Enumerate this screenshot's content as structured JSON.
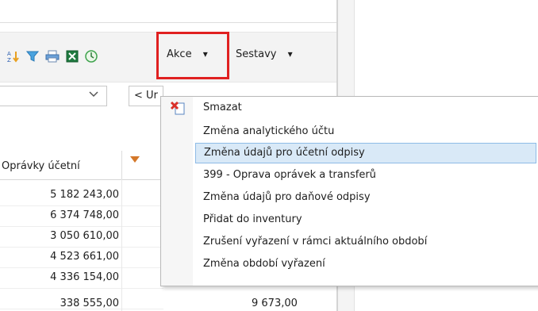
{
  "toolbar": {
    "icons": [
      "sort-az-icon",
      "filter-icon",
      "print-icon",
      "excel-icon",
      "history-icon"
    ],
    "akce_label": "Akce",
    "sestavy_label": "Sestavy",
    "dropdown_glyph": "▾"
  },
  "filters": {
    "combo_value": "",
    "combo2_value": "< Ur"
  },
  "grid": {
    "columns": [
      "Oprávky účetní"
    ],
    "rows": [
      {
        "oprávky": "5 182 243,00"
      },
      {
        "oprávky": "6 374 748,00"
      },
      {
        "oprávky": "3 050 610,00"
      },
      {
        "oprávky": "4 523 661,00"
      },
      {
        "oprávky": "4 336 154,00"
      },
      {
        "oprávky": "338 555,00"
      }
    ],
    "bottom_right_value": "9 673,00"
  },
  "menu": {
    "items": [
      {
        "label": "Smazat"
      },
      {
        "label": "Změna analytického účtu"
      },
      {
        "label": "Změna údajů pro účetní odpisy",
        "selected": true
      },
      {
        "label": "399 - Oprava oprávek a transferů"
      },
      {
        "label": "Změna údajů pro daňové odpisy"
      },
      {
        "label": "Přidat do inventury"
      },
      {
        "label": "Zrušení vyřazení v rámci aktuálního období"
      },
      {
        "label": "Změna období vyřazení"
      }
    ]
  },
  "colors": {
    "highlight_border": "#e02020",
    "menu_selected_bg": "#d9e9f7",
    "sort_arrow": "#d4782a"
  }
}
